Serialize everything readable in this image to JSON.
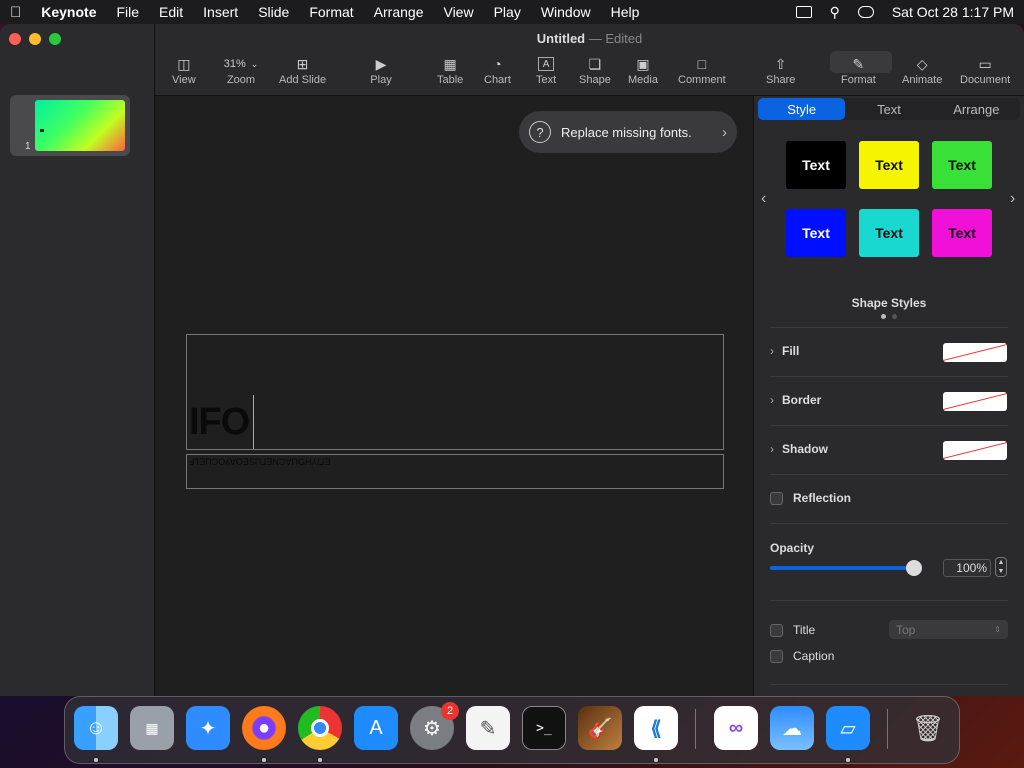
{
  "menubar": {
    "app": "Keynote",
    "items": [
      "File",
      "Edit",
      "Insert",
      "Slide",
      "Format",
      "Arrange",
      "View",
      "Play",
      "Window",
      "Help"
    ],
    "clock": "Sat Oct 28  1:17 PM"
  },
  "document": {
    "title": "Untitled",
    "status": "Edited"
  },
  "toolbar": {
    "view": "View",
    "zoom_value": "31%",
    "zoom": "Zoom",
    "add_slide": "Add Slide",
    "play": "Play",
    "table": "Table",
    "chart": "Chart",
    "text": "Text",
    "shape": "Shape",
    "media": "Media",
    "comment": "Comment",
    "share": "Share",
    "format": "Format",
    "animate": "Animate",
    "document": "Document"
  },
  "navigator": {
    "slide_number": "1"
  },
  "notice": {
    "text": "Replace missing fonts."
  },
  "slide": {
    "title_text": "IFO",
    "subtitle_text": "Ⅎ⅂ƎΠƆOʎ∀OƎSΠ⅃ƎNƆ∀ΠGH⅄Ι⅃Ǝ"
  },
  "sidebar": {
    "tabs": {
      "style": "Style",
      "text": "Text",
      "arrange": "Arrange"
    },
    "swatch_text": "Text",
    "shape_styles": "Shape Styles",
    "fill": "Fill",
    "border": "Border",
    "shadow": "Shadow",
    "reflection": "Reflection",
    "opacity": "Opacity",
    "opacity_value": "100%",
    "opacity_level": 1.0,
    "title": "Title",
    "title_position": "Top",
    "caption": "Caption"
  },
  "dock": {
    "badge": "2"
  }
}
